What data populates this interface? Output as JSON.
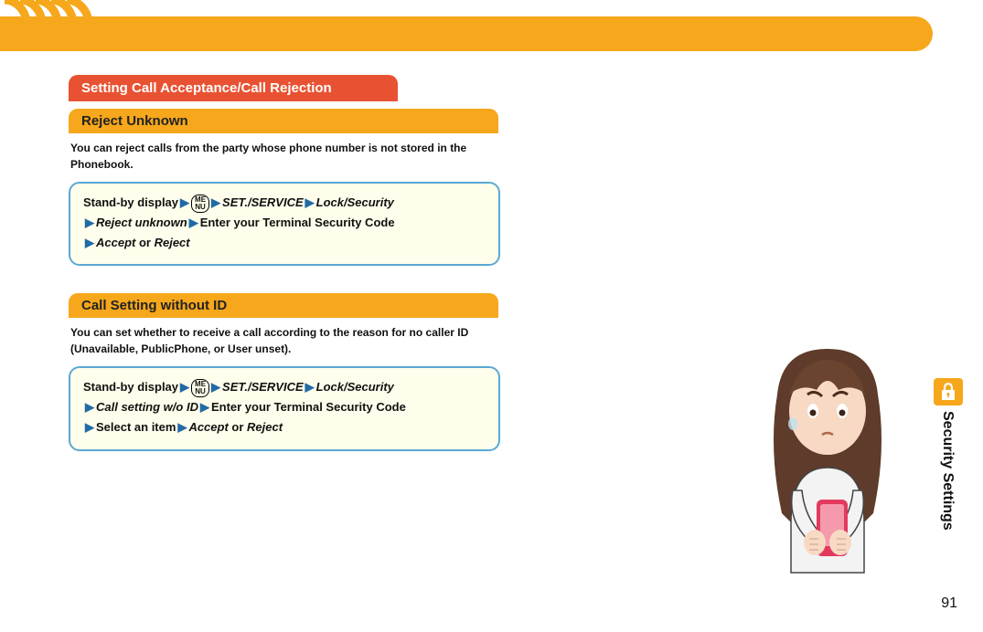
{
  "page": {
    "section_tab": "Security Settings",
    "page_number": "91"
  },
  "main_heading": "Setting Call Acceptance/Call Rejection",
  "reject_unknown": {
    "heading": "Reject Unknown",
    "desc": "You can reject calls from the party whose phone number is not stored in the Phonebook.",
    "steps": {
      "s1": "Stand-by display",
      "menu_top": "ME",
      "menu_bot": "NU",
      "s2": "SET./SERVICE",
      "s3": "Lock/Security",
      "s4": "Reject unknown",
      "s5": "Enter your Terminal Security Code",
      "s6a": "Accept",
      "s6_or": " or ",
      "s6b": "Reject"
    }
  },
  "call_setting": {
    "heading": "Call Setting without ID",
    "desc": "You can set whether to receive a call according to the reason for no caller ID (Unavailable, PublicPhone, or User unset).",
    "steps": {
      "s1": "Stand-by display",
      "menu_top": "ME",
      "menu_bot": "NU",
      "s2": "SET./SERVICE",
      "s3": "Lock/Security",
      "s4": "Call setting w/o ID",
      "s5": "Enter your Terminal Security Code",
      "s6": "Select an item",
      "s7a": "Accept",
      "s7_or": " or ",
      "s7b": "Reject"
    }
  }
}
